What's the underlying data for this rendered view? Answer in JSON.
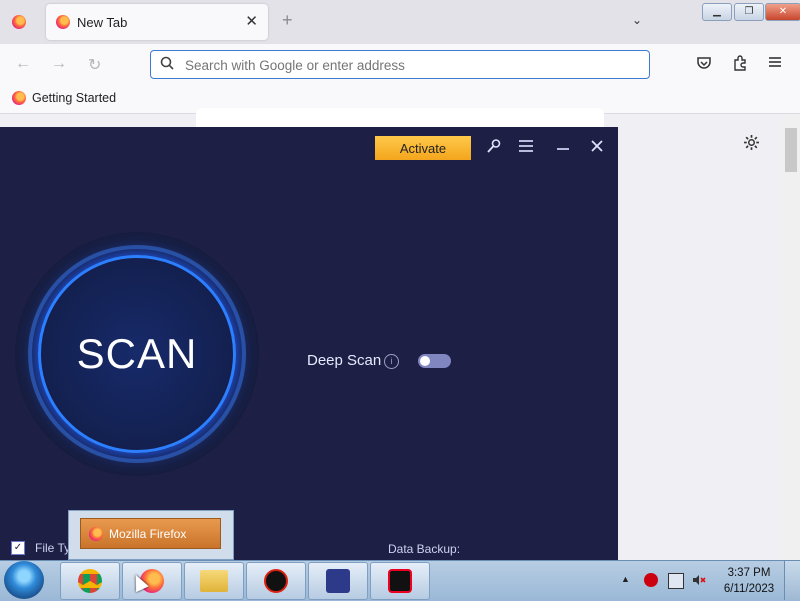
{
  "browser": {
    "tab": {
      "title": "New Tab",
      "close": "✕"
    },
    "new_tab_symbol": "+",
    "tab_list_symbol": "⌄",
    "window_buttons": {
      "minimize": "▁",
      "maximize": "❐",
      "close": "✕"
    },
    "nav": {
      "back": "←",
      "forward": "→",
      "reload": "↻"
    },
    "urlbar": {
      "placeholder": "Search with Google or enter address",
      "icon": "search-icon"
    },
    "toolbar_icons": [
      "pocket-icon",
      "extensions-icon",
      "menu-icon"
    ],
    "bookmarks": [
      {
        "label": "Getting Started"
      }
    ],
    "settings_icon": "gear-icon"
  },
  "app": {
    "activate_label": "Activate",
    "scan_label": "SCAN",
    "deep_scan_label": "Deep Scan",
    "deep_scan_info": "i",
    "deep_scan_enabled": false,
    "file_types_label": "File Ty",
    "file_types_checked": true,
    "data_backup_label": "Data Backup:",
    "icons": [
      "key-icon",
      "menu-icon",
      "minimize-icon",
      "close-icon"
    ],
    "colors": {
      "background": "#1e1f45",
      "accent": "#f4a51c",
      "scan_ring": "#2c7fff"
    }
  },
  "taskbar": {
    "apps": [
      "chrome",
      "firefox",
      "file-explorer",
      "antivirus-app",
      "backup-app",
      "screen-recorder"
    ],
    "thumbnail_label": "Mozilla Firefox",
    "clock": {
      "time": "3:37 PM",
      "date": "6/11/2023"
    }
  }
}
